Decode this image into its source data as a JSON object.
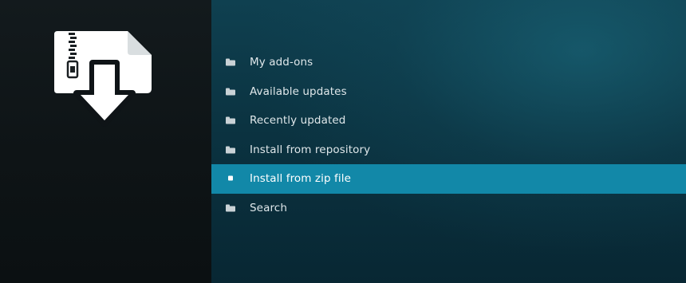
{
  "menu": {
    "items": [
      {
        "label": "My add-ons",
        "icon": "folder-icon",
        "selected": false
      },
      {
        "label": "Available updates",
        "icon": "folder-icon",
        "selected": false
      },
      {
        "label": "Recently updated",
        "icon": "folder-icon",
        "selected": false
      },
      {
        "label": "Install from repository",
        "icon": "folder-icon",
        "selected": false
      },
      {
        "label": "Install from zip file",
        "icon": "square-bullet-icon",
        "selected": true
      },
      {
        "label": "Search",
        "icon": "folder-icon",
        "selected": false
      }
    ]
  },
  "colors": {
    "selection": "#1288a8",
    "left_panel": "#0e1416",
    "right_panel": "#0b3341"
  },
  "art": {
    "icon": "zip-file-download-icon"
  }
}
